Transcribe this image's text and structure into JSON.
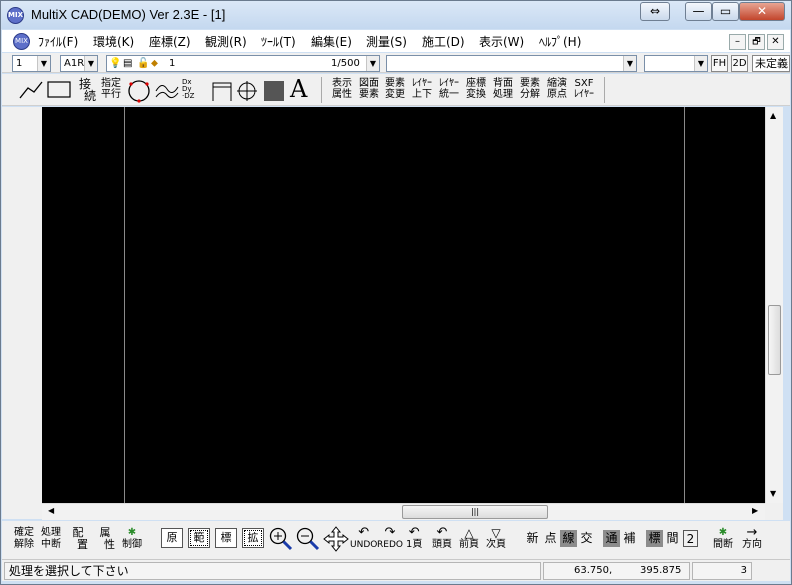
{
  "window": {
    "title": "MultiX CAD(DEMO)   Ver 2.3E - [1]",
    "icon": "MIX",
    "maximize": "⇔",
    "minimize": "—",
    "restore": "▭",
    "close": "✕"
  },
  "menu": [
    "ﾌｧｲﾙ(F)",
    "環境(K)",
    "座標(Z)",
    "観測(R)",
    "ﾂｰﾙ(T)",
    "編集(E)",
    "測量(S)",
    "施工(D)",
    "表示(W)",
    "ﾍﾙﾌﾟ(H)"
  ],
  "mdi": {
    "min": "–",
    "restore": "🗗",
    "close": "✕"
  },
  "toolbar1": {
    "layer_no": "1",
    "paper": "A1R",
    "layer_name": "1",
    "scale": "1/500",
    "fh": "FH",
    "mode2d": "2D",
    "undef": "未定義"
  },
  "toolbar2": {
    "b_connect": [
      "接",
      "続"
    ],
    "b_parallel": [
      "指定",
      "平行"
    ],
    "grp": [
      [
        "表示",
        "属性"
      ],
      [
        "図面",
        "要素"
      ],
      [
        "要素",
        "変更"
      ],
      [
        "ﾚｲﾔｰ",
        "上下"
      ],
      [
        "ﾚｲﾔｰ",
        "統一"
      ],
      [
        "座標",
        "変換"
      ],
      [
        "背面",
        "処理"
      ],
      [
        "要素",
        "分解"
      ],
      [
        "縮演",
        "原点"
      ],
      [
        "SXF",
        "ﾚｲﾔｰ"
      ]
    ]
  },
  "bottom": {
    "b1": [
      "確定",
      "解除"
    ],
    "b2": [
      "処理",
      "中断"
    ],
    "b3": [
      "配",
      "置"
    ],
    "b4": [
      "属",
      "性"
    ],
    "b5": [
      "✱",
      "制御"
    ],
    "boxes": [
      "原",
      "範",
      "標",
      "拡"
    ],
    "nav": [
      "UNDO",
      "REDO",
      "1頁",
      "頭頁",
      "前頁",
      "次頁"
    ],
    "seg1": [
      "新",
      "点",
      "線",
      "交"
    ],
    "seg2": [
      "通",
      "補"
    ],
    "seg3": [
      "標",
      "間",
      "2"
    ],
    "b6": [
      "✱",
      "間断"
    ],
    "b7": [
      "→",
      "方向"
    ]
  },
  "status": {
    "message": "処理を選択して下さい",
    "x": "63.750,",
    "y": "395.875",
    "count": "3"
  }
}
